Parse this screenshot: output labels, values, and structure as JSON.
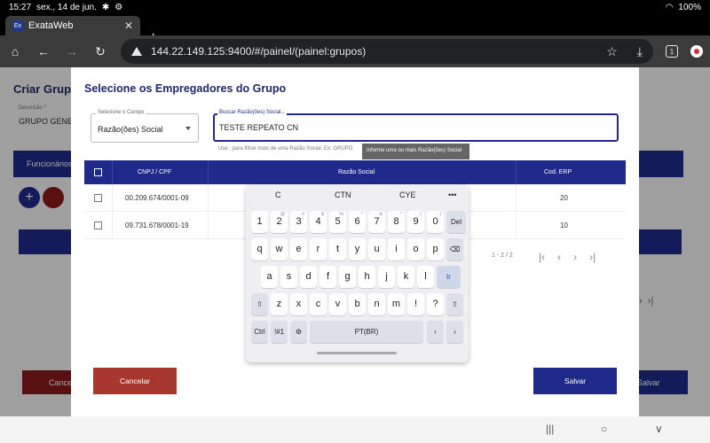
{
  "status": {
    "time": "15:27",
    "date": "sex., 14 de jun.",
    "battery": "100%"
  },
  "browser": {
    "tab_title": "ExataWeb",
    "favicon_text": "Ex",
    "url": "144.22.149.125:9400/#/painel/(painel:grupos)",
    "tab_count": "1"
  },
  "background_page": {
    "title": "Criar Grupo",
    "description_label": "Descrição *",
    "description_value": "GRUPO GENER",
    "nav_tab": "Funcionários",
    "cancel": "Cance",
    "save": "Salvar"
  },
  "modal": {
    "title": "Selecione os Empregadores do Grupo",
    "select_label": "Selecione o Campo",
    "select_value": "Razão(ões) Social",
    "search_label": "Buscar Razão(ões) Social...",
    "search_value": "TESTE REPEATO CN",
    "hint": "Use ; para filtrar mais de uma Razão Social. Ex: GRUPO",
    "tooltip": "Informe uma ou mais Razão(ões) Social",
    "columns": [
      "CNPJ / CPF",
      "Razão Social",
      "Cod. ERP"
    ],
    "rows": [
      {
        "cnpj": "00.209.674/0001-09",
        "razao": "",
        "cod": "20"
      },
      {
        "cnpj": "09.731.678/0001-19",
        "razao": "",
        "cod": "10"
      }
    ],
    "pagination": "1 - 2 / 2",
    "cancel_label": "Cancelar",
    "save_label": "Salvar"
  },
  "keyboard": {
    "suggestions": [
      "C",
      "CTN",
      "CYE",
      "•••"
    ],
    "row1": [
      "1",
      "2",
      "3",
      "4",
      "5",
      "6",
      "7",
      "8",
      "9",
      "0",
      "Del"
    ],
    "row1_sup": [
      "",
      "@",
      "#",
      "$",
      "%",
      "^",
      "&",
      "*",
      "(",
      ")",
      ""
    ],
    "row2": [
      "q",
      "w",
      "e",
      "r",
      "t",
      "y",
      "u",
      "i",
      "o",
      "p",
      "⌫"
    ],
    "row3": [
      "a",
      "s",
      "d",
      "f",
      "g",
      "h",
      "j",
      "k",
      "l",
      "Ir"
    ],
    "row4": [
      "⇧",
      "z",
      "x",
      "c",
      "v",
      "b",
      "n",
      "m",
      "!",
      "?",
      "⇧"
    ],
    "row5": [
      "Ctrl",
      "!#1",
      "⚙",
      "PT(BR)",
      "‹",
      "›"
    ]
  }
}
